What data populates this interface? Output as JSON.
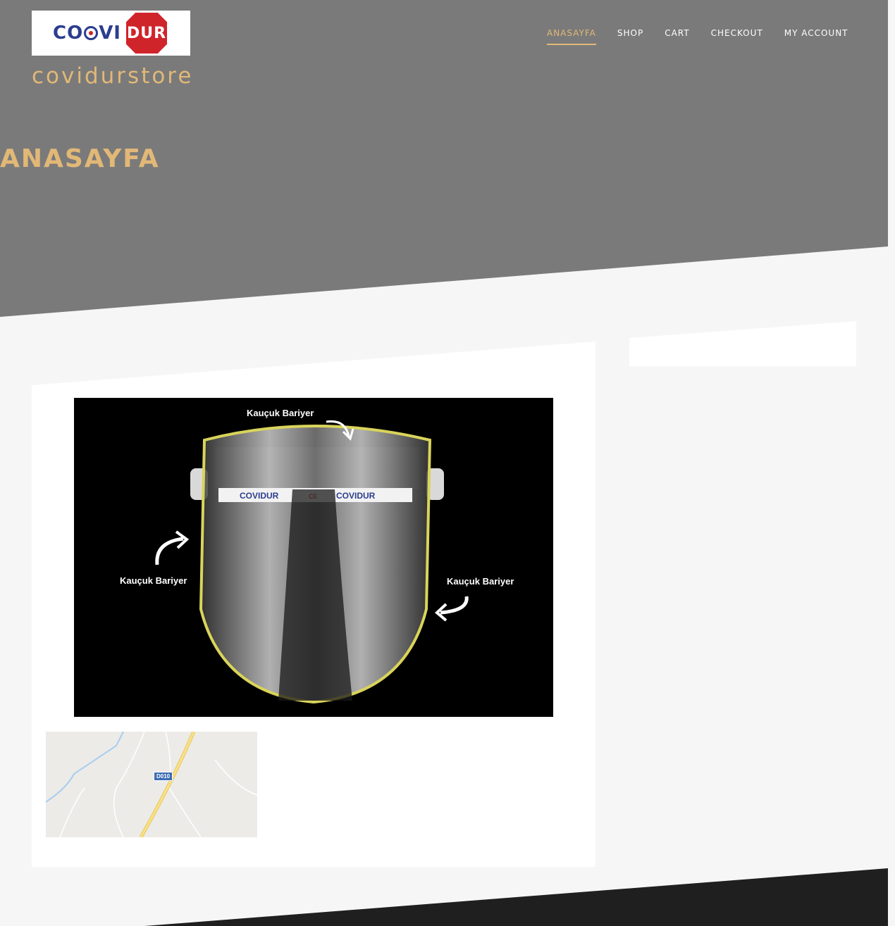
{
  "header": {
    "logo": {
      "text_left": "CO",
      "text_mid": "VI",
      "text_right": "DUR",
      "alt": "covidur logo"
    },
    "site_title": "covidurstore"
  },
  "nav": {
    "items": [
      {
        "label": "ANASAYFA",
        "active": true
      },
      {
        "label": "SHOP",
        "active": false
      },
      {
        "label": "CART",
        "active": false
      },
      {
        "label": "CHECKOUT",
        "active": false
      },
      {
        "label": "MY ACCOUNT",
        "active": false
      }
    ]
  },
  "page": {
    "heading": "ANASAYFA"
  },
  "product_image": {
    "labels": [
      "Kauçuk Bariyer",
      "Kauçuk Bariyer",
      "Kauçuk Bariyer"
    ],
    "band_text_1": "COVIDUR",
    "band_text_2": "COVIDUR",
    "ce_mark": "CE"
  },
  "map": {
    "road_label": "D010"
  },
  "colors": {
    "hero_bg": "#7a7a7a",
    "accent": "#e2b877",
    "page_bg": "#f6f6f6",
    "footer": "#1f1f1f",
    "logo_blue": "#2b3d8f",
    "logo_red": "#d0242b"
  }
}
